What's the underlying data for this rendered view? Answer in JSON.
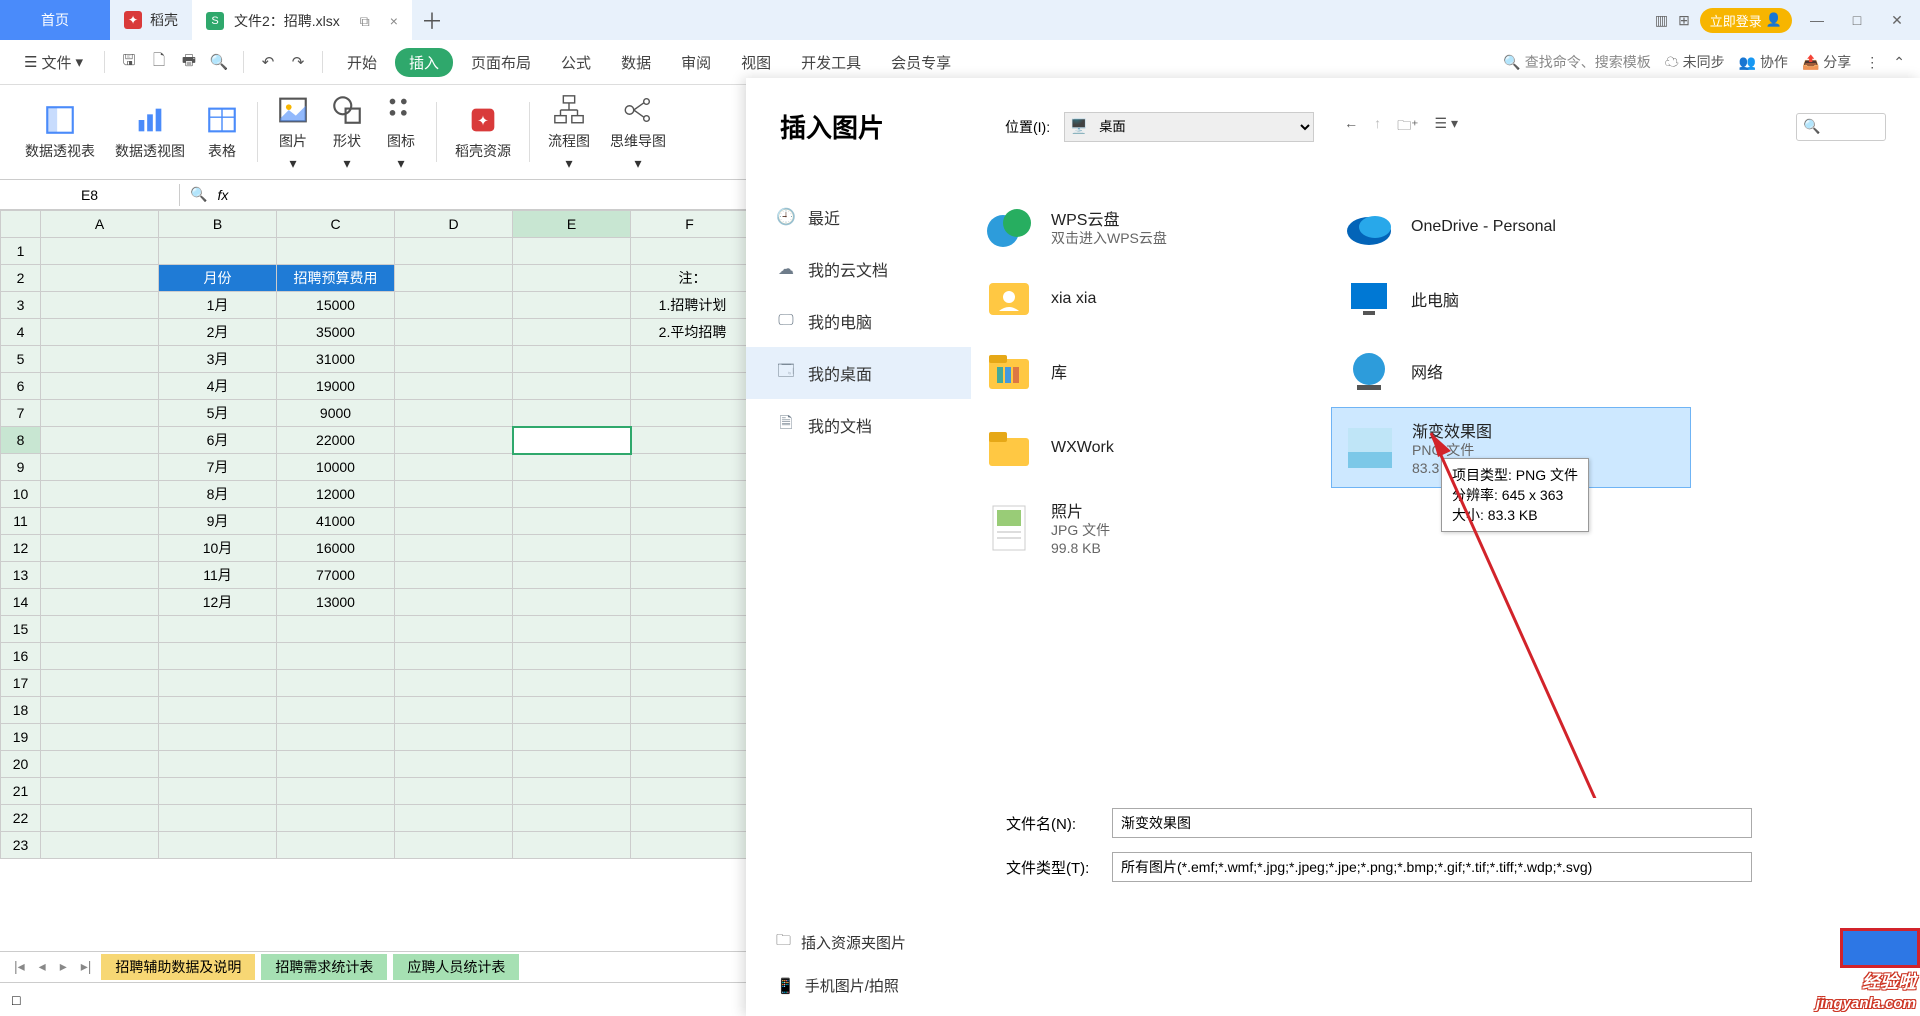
{
  "titlebar": {
    "home": "首页",
    "daoke": "稻壳",
    "file_tab": "文件2：招聘.xlsx",
    "splitview_icon": "⧉",
    "close_icon": "×",
    "add_icon": "＋",
    "login": "立即登录"
  },
  "menubar": {
    "file": "文件",
    "items": [
      "开始",
      "插入",
      "页面布局",
      "公式",
      "数据",
      "审阅",
      "视图",
      "开发工具",
      "会员专享"
    ],
    "search_placeholder": "查找命令、搜索模板",
    "sync": "未同步",
    "coop": "协作",
    "share": "分享"
  },
  "ribbon": {
    "pivot": "数据透视表",
    "pivotchart": "数据透视图",
    "table": "表格",
    "picture": "图片",
    "shape": "形状",
    "icon": "图标",
    "daoke": "稻壳资源",
    "flow": "流程图",
    "mind": "思维导图"
  },
  "formulabar": {
    "cell": "E8",
    "fx": "fx"
  },
  "cols": [
    "A",
    "B",
    "C",
    "D",
    "E",
    "F"
  ],
  "rows": [
    "1",
    "2",
    "3",
    "4",
    "5",
    "6",
    "7",
    "8",
    "9",
    "10",
    "11",
    "12",
    "13",
    "14",
    "15",
    "16",
    "17",
    "18",
    "19",
    "20",
    "21",
    "22",
    "23"
  ],
  "table_header": {
    "c1": "月份",
    "c2": "招聘预算费用"
  },
  "notes": {
    "n1": "注：",
    "n2": "1.招聘计划",
    "n3": "2.平均招聘"
  },
  "chart_data": {
    "type": "table",
    "categories": [
      "1月",
      "2月",
      "3月",
      "4月",
      "5月",
      "6月",
      "7月",
      "8月",
      "9月",
      "10月",
      "11月",
      "12月"
    ],
    "values": [
      15000,
      35000,
      31000,
      19000,
      9000,
      22000,
      10000,
      12000,
      41000,
      16000,
      77000,
      13000
    ],
    "title": "招聘预算费用",
    "xlabel": "月份",
    "ylabel": "招聘预算费用"
  },
  "sheettabs": {
    "t1": "招聘辅助数据及说明",
    "t2": "招聘需求统计表",
    "t3": "应聘人员统计表"
  },
  "dialog": {
    "title": "插入图片",
    "loc_label": "位置(I):",
    "loc_value": "桌面",
    "sidebar": [
      {
        "icon": "clock",
        "label": "最近"
      },
      {
        "icon": "cloud",
        "label": "我的云文档"
      },
      {
        "icon": "monitor",
        "label": "我的电脑"
      },
      {
        "icon": "desktop",
        "label": "我的桌面"
      },
      {
        "icon": "doc",
        "label": "我的文档"
      }
    ],
    "files": [
      {
        "icon": "wps",
        "name": "WPS云盘",
        "sub": "双击进入WPS云盘"
      },
      {
        "icon": "onedrive",
        "name": "OneDrive - Personal",
        "sub": ""
      },
      {
        "icon": "user",
        "name": "xia xia",
        "sub": ""
      },
      {
        "icon": "thispc",
        "name": "此电脑",
        "sub": ""
      },
      {
        "icon": "lib",
        "name": "库",
        "sub": ""
      },
      {
        "icon": "net",
        "name": "网络",
        "sub": ""
      },
      {
        "icon": "folder",
        "name": "WXWork",
        "sub": ""
      },
      {
        "icon": "png",
        "name": "渐变效果图",
        "sub": "PNG 文件\n83.3 KB",
        "selected": true
      },
      {
        "icon": "jpg",
        "name": "照片",
        "sub": "JPG 文件\n99.8 KB"
      }
    ],
    "tooltip": {
      "l1": "项目类型: PNG 文件",
      "l2": "分辨率: 645 x 363",
      "l3": "大小: 83.3 KB"
    },
    "filename_label": "文件名(N):",
    "filename_value": "渐变效果图",
    "filetype_label": "文件类型(T):",
    "filetype_value": "所有图片(*.emf;*.wmf;*.jpg;*.jpeg;*.jpe;*.png;*.bmp;*.gif;*.tif;*.tiff;*.wdp;*.svg)",
    "bottom": {
      "a1": "插入资源夹图片",
      "a2": "手机图片/拍照"
    }
  },
  "watermark": {
    "l1": "经验啦",
    "l2": "jingyanla.com"
  }
}
